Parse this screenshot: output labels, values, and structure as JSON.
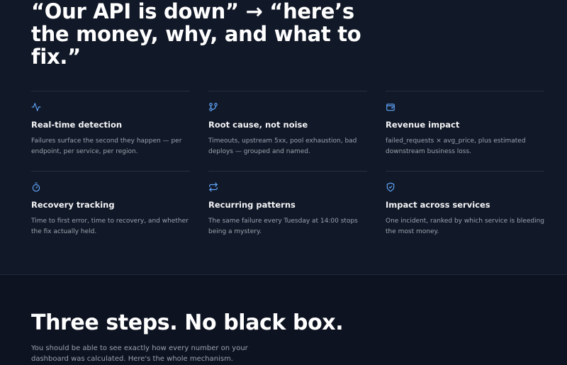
{
  "hero": {
    "title": "“Our API is down” → “here’s the money, why, and what to fix.”"
  },
  "features": [
    {
      "icon": "activity-icon",
      "title": "Real-time detection",
      "desc": "Failures surface the second they happen — per endpoint, per service, per region."
    },
    {
      "icon": "git-branch-icon",
      "title": "Root cause, not noise",
      "desc": "Timeouts, upstream 5xx, pool exhaustion, bad deploys — grouped and named."
    },
    {
      "icon": "wallet-icon",
      "title": "Revenue impact",
      "desc": "failed_requests × avg_price, plus estimated downstream business loss."
    },
    {
      "icon": "timer-icon",
      "title": "Recovery tracking",
      "desc": "Time to first error, time to recovery, and whether the fix actually held."
    },
    {
      "icon": "repeat-icon",
      "title": "Recurring patterns",
      "desc": "The same failure every Tuesday at 14:00 stops being a mystery."
    },
    {
      "icon": "shield-check-icon",
      "title": "Impact across services",
      "desc": "One incident, ranked by which service is bleeding the most money."
    }
  ],
  "steps": {
    "title": "Three steps. No black box.",
    "subtitle": "You should be able to see exactly how every number on your dashboard was calculated. Here's the whole mechanism."
  },
  "colors": {
    "accent": "#60a5fa",
    "background": "#111827",
    "section_background": "#0d1321"
  }
}
